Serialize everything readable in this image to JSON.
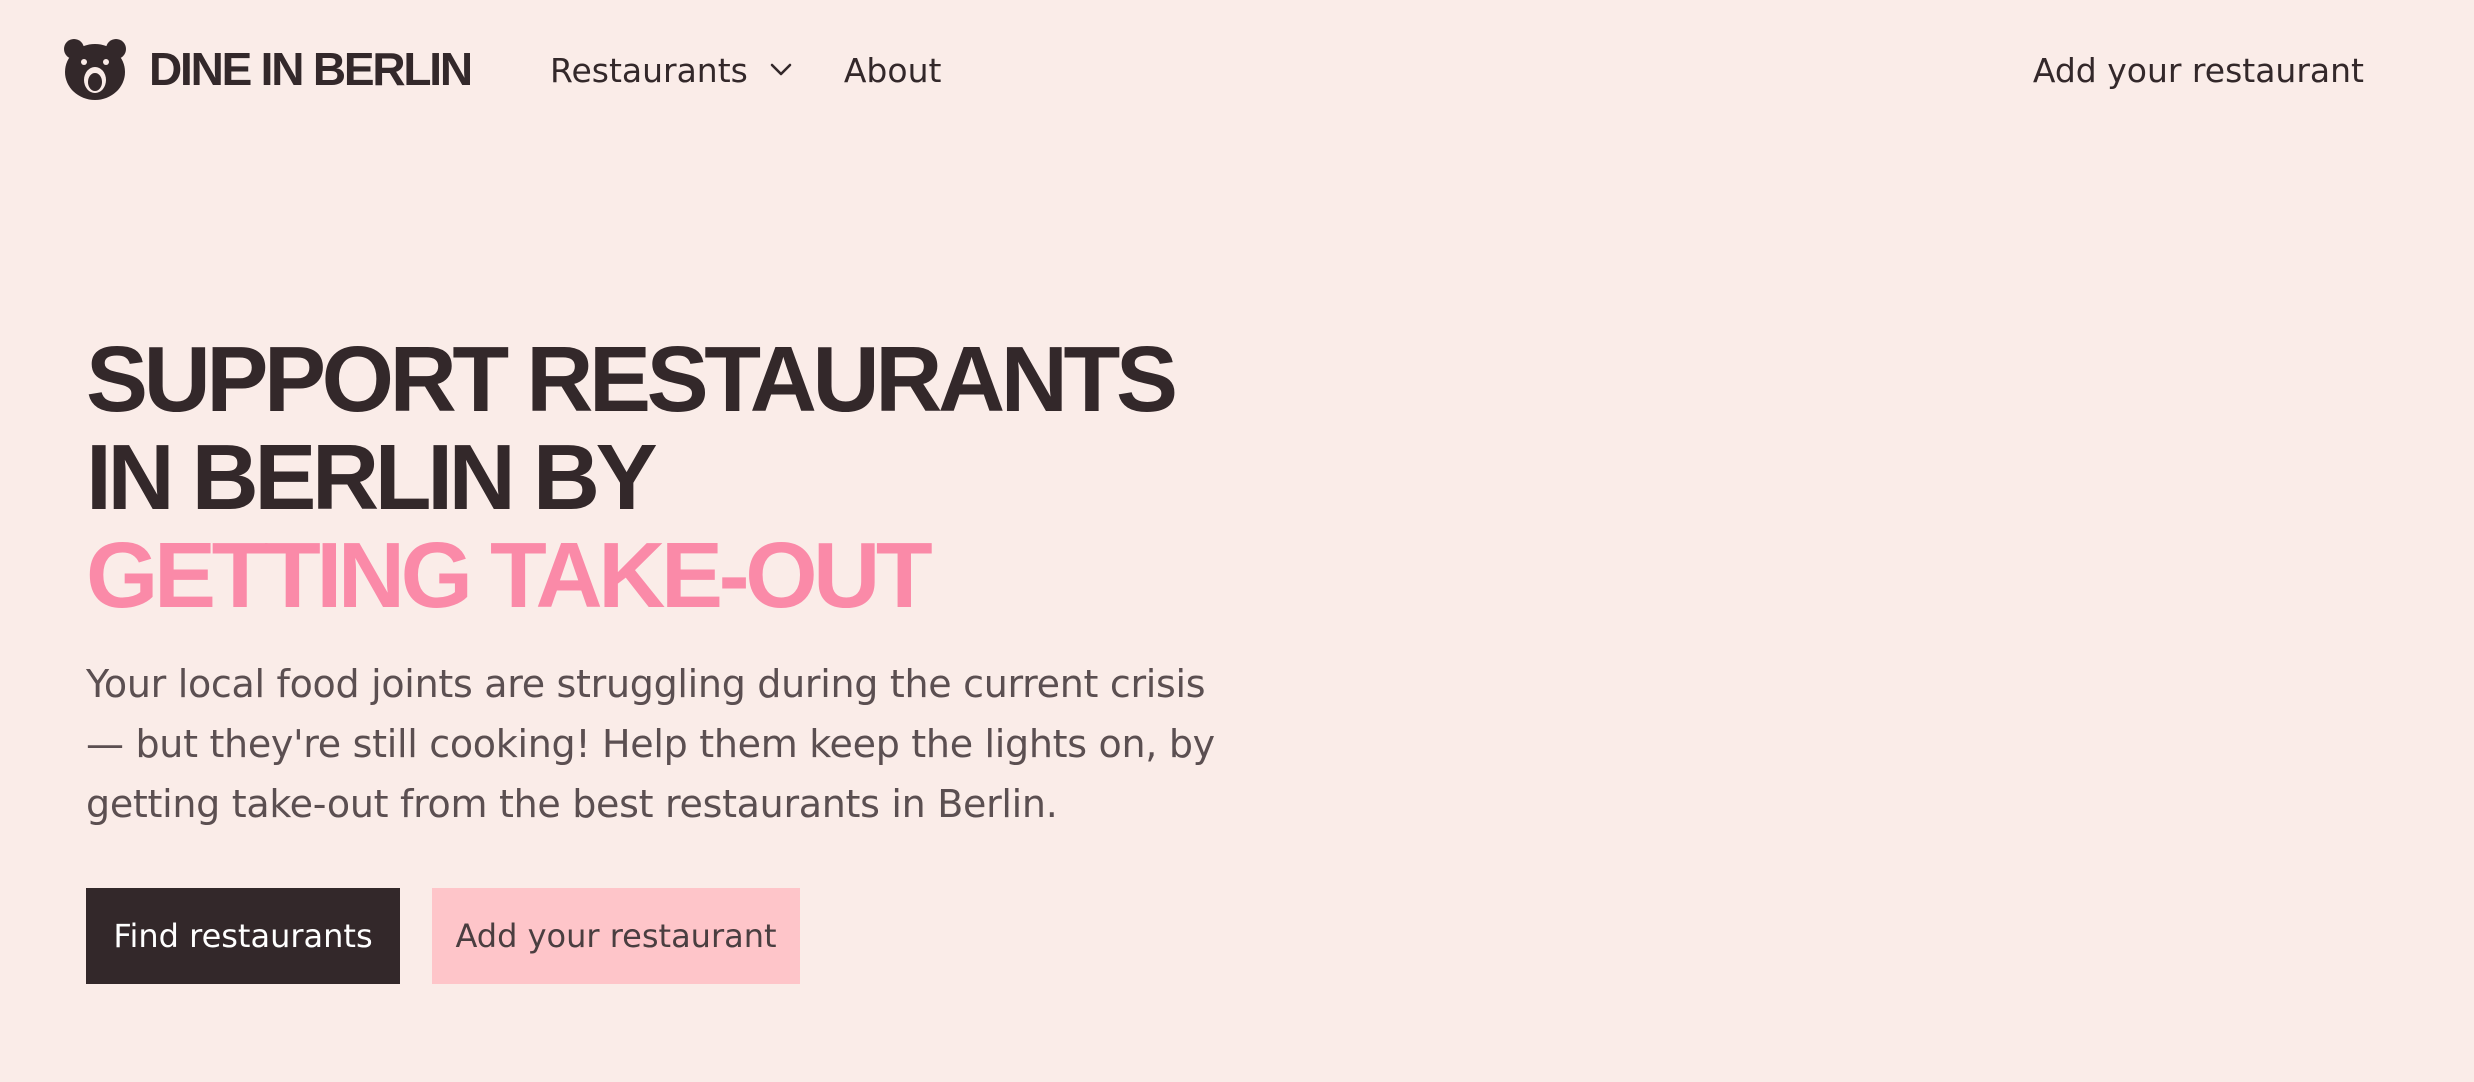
{
  "brand": {
    "name": "DINE IN BERLIN",
    "logo_icon": "bear-head-icon"
  },
  "nav": {
    "restaurants_label": "Restaurants",
    "restaurants_icon": "chevron-down-icon",
    "about_label": "About"
  },
  "header": {
    "cta_label": "Add your restaurant"
  },
  "hero": {
    "title_line1": "SUPPORT RESTAURANTS",
    "title_line2": "IN BERLIN BY",
    "title_accent": "GETTING TAKE-OUT",
    "description": "Your local food joints are struggling during the current crisis — but they're still cooking! Help them keep the lights on, by getting take-out from the best restaurants in Berlin.",
    "primary_button": "Find restaurants",
    "secondary_button": "Add your restaurant"
  },
  "colors": {
    "background": "#faece8",
    "text_dark": "#33282a",
    "accent_pink": "#fa8aa8",
    "button_pink": "#fec5c9"
  }
}
